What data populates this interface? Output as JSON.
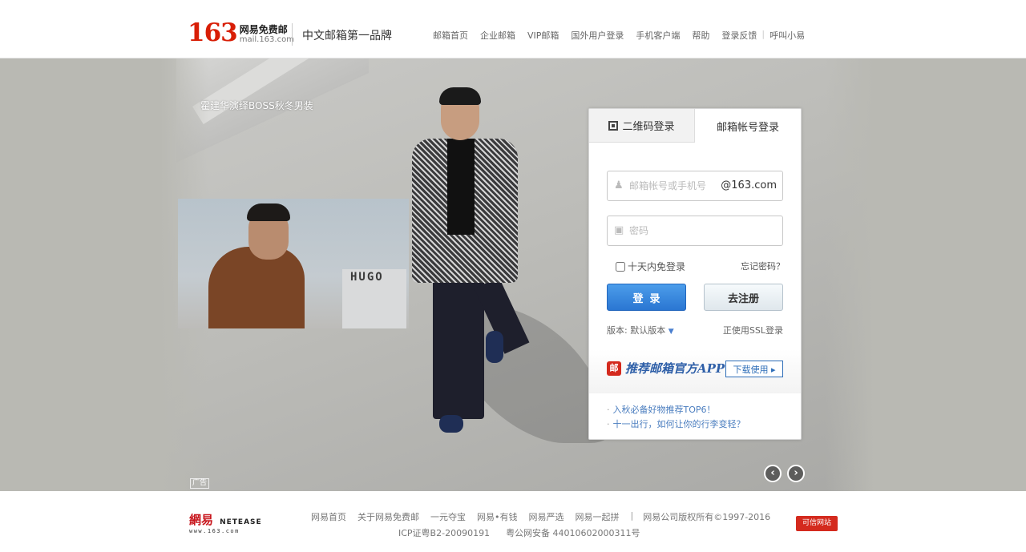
{
  "header": {
    "logo_number": "163",
    "logo_cn": "网易免费邮",
    "logo_en": "mail.163.com",
    "slogan": "中文邮箱第一品牌",
    "nav": [
      "邮箱首页",
      "企业邮箱",
      "VIP邮箱",
      "国外用户登录",
      "手机客户端",
      "帮助",
      "登录反馈",
      "呼叫小易"
    ]
  },
  "banner": {
    "caption": "霍建华演绎BOSS秋冬男装",
    "inset_sign": "HUGO",
    "ad_tag": "广告",
    "prev_arrow": "‹",
    "next_arrow": "›"
  },
  "login": {
    "tabs": {
      "qr": "二维码登录",
      "account": "邮箱帐号登录"
    },
    "username_placeholder": "邮箱帐号或手机号",
    "domain_suffix": "@163.com",
    "password_placeholder": "密码",
    "remember_label": "十天内免登录",
    "forgot_label": "忘记密码？",
    "login_button": "登录",
    "register_button": "去注册",
    "version_label": "版本: 默认版本",
    "ssl_label": "正使用SSL登录",
    "app_icon_text": "邮",
    "app_slogan": "推荐邮箱官方APP",
    "download_button": "下载使用 ▸",
    "news": [
      "入秋必备好物推荐TOP6！",
      "十一出行，如何让你的行李变轻？"
    ]
  },
  "footer": {
    "ne_cn": "網易",
    "ne_en": "NETEASE",
    "ne_url": "www.163.com",
    "links": [
      "网易首页",
      "关于网易免费邮",
      "一元夺宝",
      "网易•有钱",
      "网易严选",
      "网易一起拼"
    ],
    "copyright": "网易公司版权所有©1997-2016",
    "icp": "ICP证粤B2-20090191",
    "police": "粤公网安备 44010602000311号",
    "trust_badge": "可信网站"
  },
  "colors": {
    "brand_red": "#d81e06",
    "login_blue": "#2a76d2",
    "banner_bg": "#b9b9b3"
  }
}
